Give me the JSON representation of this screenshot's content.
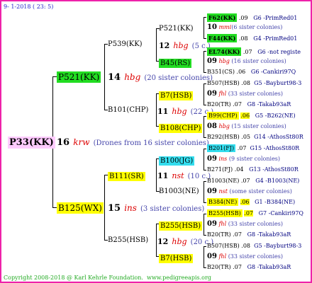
{
  "header": {
    "date": "9-  1-2018 ( 23:  5)"
  },
  "footer": {
    "copyright": "Copyright 2008-2018 @ Karl Kehrle Foundation.",
    "url": "www.pedigreeapis.org"
  },
  "root": {
    "id": "P33(KK)",
    "num": "16",
    "code": "krw",
    "note": "(Drones from 16 sister colonies)"
  },
  "p521": {
    "id": "P521(KK)",
    "num": "14",
    "code": "hbg",
    "note": "(20 sister colonies)"
  },
  "p539": {
    "id": "P539(KK)"
  },
  "p521b": {
    "id": "P521(KK)",
    "num": "12",
    "code": "hbg",
    "note": "(5 c.)"
  },
  "f62": {
    "id": "F62(KK)",
    "year": ".09",
    "pre": "G6 -",
    "name": "PrimRed01"
  },
  "row2": {
    "num": "10",
    "code": "mmi",
    "note": "(6 sister colonies)"
  },
  "f44": {
    "id": "F44(KK)",
    "year": ".08",
    "pre": "G4 -",
    "name": "PrimRed01"
  },
  "b45": {
    "id": "B45(RS)"
  },
  "el74": {
    "id": "EL74(KK)",
    "year": ".07",
    "pre": "G6 -",
    "name": "not registe"
  },
  "row5": {
    "num": "09",
    "code": "hbg",
    "note": "(16 sister colonies)"
  },
  "b351": {
    "id": "B351(CS)",
    "year": ".06",
    "pre": "G6 -",
    "name": "Cankiri97Q"
  },
  "b101": {
    "id": "B101(CHP)",
    "num": "11",
    "code": "hbg",
    "note": "(22 c.)"
  },
  "b507a": {
    "id": "B507(HSB)",
    "year": ".08",
    "pre": "G5 -",
    "name": "Bayburt98-3"
  },
  "b7a": {
    "id": "B7(HSB)"
  },
  "row8": {
    "num": "09",
    "code": "fhl",
    "note": "(33 sister colonies)"
  },
  "b20a": {
    "id": "B20(TR)",
    "year": ".07",
    "pre": "G8 -",
    "name": "Takab93aR"
  },
  "b99": {
    "id": "B99(CHP)",
    "year": ".06",
    "pre": "G5 -",
    "name": "B262(NE)"
  },
  "b108": {
    "id": "B108(CHP)"
  },
  "row11": {
    "num": "08",
    "code": "hbg",
    "note": "(15 sister colonies)"
  },
  "b292": {
    "id": "B292(HSB)",
    "year": ".05",
    "pre": "G14 -",
    "name": "AthosSt80R"
  },
  "b125": {
    "id": "B125(WX)",
    "num": "15",
    "code": "ins",
    "note": "(3 sister colonies)"
  },
  "b111": {
    "id": "B111(SR)",
    "num": "11",
    "code": "nst",
    "note": "(10 c.)"
  },
  "b201": {
    "id": "B201(FJ)",
    "year": ".07",
    "pre": "G15 -",
    "name": "AthosSt80R"
  },
  "b100": {
    "id": "B100(JG)"
  },
  "row14": {
    "num": "09",
    "code": "ins",
    "note": "(9 sister colonies)"
  },
  "b271": {
    "id": "B271(FJ)",
    "year": ".04",
    "pre": "G13 -",
    "name": "AthosSt80R"
  },
  "b1003a": {
    "id": "B1003(NE)",
    "year": ".07",
    "pre": "G4 -",
    "name": "B1003(NE)"
  },
  "b1003": {
    "id": "B1003(NE)"
  },
  "row17": {
    "num": "09",
    "code": "nst",
    "note": "(some sister colonies)"
  },
  "b384": {
    "id": "B384(NE)",
    "year": ".06",
    "pre": "G1 -",
    "name": "B384(NE)"
  },
  "b255": {
    "id": "B255(HSB)",
    "num": "12",
    "code": "hbg",
    "note": "(20 c.)"
  },
  "b255a": {
    "id": "B255(HSB)",
    "year": ".07",
    "pre": "G7 -",
    "name": "Cankiri97Q"
  },
  "b255b": {
    "id": "B255(HSB)"
  },
  "row20": {
    "num": "09",
    "code": "fhl",
    "note": "(33 sister colonies)"
  },
  "b20b": {
    "id": "B20(TR)",
    "year": ".07",
    "pre": "G8 -",
    "name": "Takab93aR"
  },
  "b507b": {
    "id": "B507(HSB)",
    "year": ".08",
    "pre": "G5 -",
    "name": "Bayburt98-3"
  },
  "b7b": {
    "id": "B7(HSB)"
  },
  "row23": {
    "num": "09",
    "code": "fhl",
    "note": "(33 sister colonies)"
  },
  "b20c": {
    "id": "B20(TR)",
    "year": ".07",
    "pre": "G8 -",
    "name": "Takab93aR"
  }
}
